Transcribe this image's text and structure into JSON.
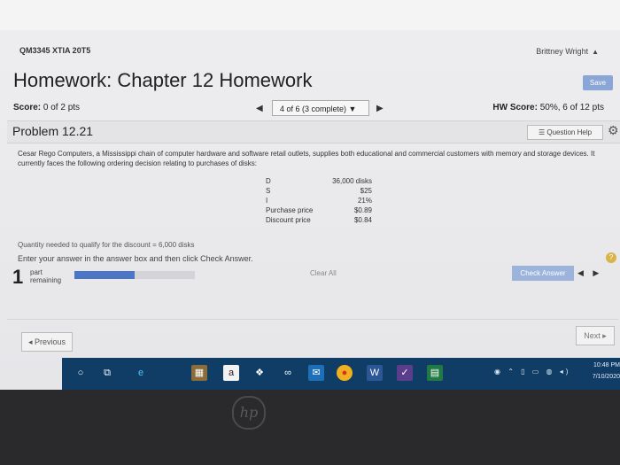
{
  "header": {
    "course": "QM3345 XTIA 20T5",
    "user": "Brittney Wright",
    "title": "Homework: Chapter 12 Homework",
    "save_label": "Save"
  },
  "score_bar": {
    "score_label": "Score:",
    "score_value": "0 of 2 pts",
    "nav_label": "4 of 6 (3 complete) ▼",
    "hw_score_label": "HW Score:",
    "hw_score_value": "50%, 6 of 12 pts"
  },
  "problem": {
    "title": "Problem 12.21",
    "help_label": "Question Help",
    "prompt": "Cesar Rego Computers, a Mississippi chain of computer hardware and software retail outlets, supplies both educational and commercial customers with memory and storage devices. It currently faces the following ordering decision relating to purchases of disks:",
    "table": [
      {
        "label": "D",
        "value": "36,000 disks"
      },
      {
        "label": "S",
        "value": "$25"
      },
      {
        "label": "I",
        "value": "21%"
      },
      {
        "label": "Purchase price",
        "value": "$0.89"
      },
      {
        "label": "Discount price",
        "value": "$0.84"
      }
    ],
    "cut_line": "Quantity needed to qualify for the discount = 6,000 disks",
    "instructions": "Enter your answer in the answer box and then click Check Answer."
  },
  "footer": {
    "parts_number": "1",
    "parts_label_1": "part",
    "parts_label_2": "remaining",
    "progress_fraction": 0.5,
    "clear_all": "Clear All",
    "check_answer": "Check Answer",
    "previous": "◂ Previous",
    "next": "Next ▸"
  },
  "taskbar": {
    "time": "10:48 PM",
    "date": "7/10/2020"
  },
  "icons": [
    "user-icon",
    "settings-gear-icon",
    "help-icon",
    "search-icon",
    "task-view-icon",
    "edge-icon",
    "store-icon",
    "amazon-icon",
    "dropbox-icon",
    "infinity-icon",
    "mail-icon",
    "chrome-icon",
    "word-icon",
    "check-icon",
    "excel-icon",
    "hp-logo-icon"
  ],
  "colors": {
    "accent": "#4c76c4",
    "taskbar": "#0f3d66",
    "save_button": "#8aa6d6"
  }
}
